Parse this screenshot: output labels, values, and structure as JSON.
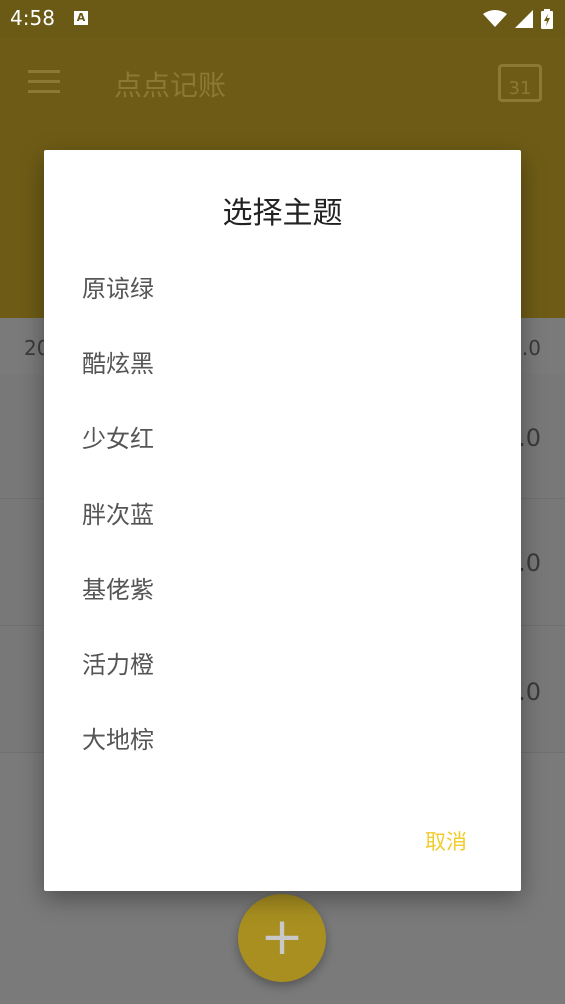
{
  "status_bar": {
    "time": "4:58",
    "notification_icon": "A"
  },
  "app": {
    "title": "点点记账",
    "calendar_day": "31"
  },
  "background_rows": {
    "header_left": "20",
    "header_right": "0.0",
    "row_values": [
      ".0",
      ".0",
      ".0"
    ]
  },
  "dialog": {
    "title": "选择主题",
    "themes": [
      "原谅绿",
      "酷炫黑",
      "少女红",
      "胖次蓝",
      "基佬紫",
      "活力橙",
      "大地棕"
    ],
    "cancel_label": "取消"
  },
  "fab": {
    "label": "+"
  },
  "colors": {
    "accent": "#f0cc2c",
    "status_bar": "#6a5a16",
    "app_bar_dimmed": "#6e5c16"
  }
}
